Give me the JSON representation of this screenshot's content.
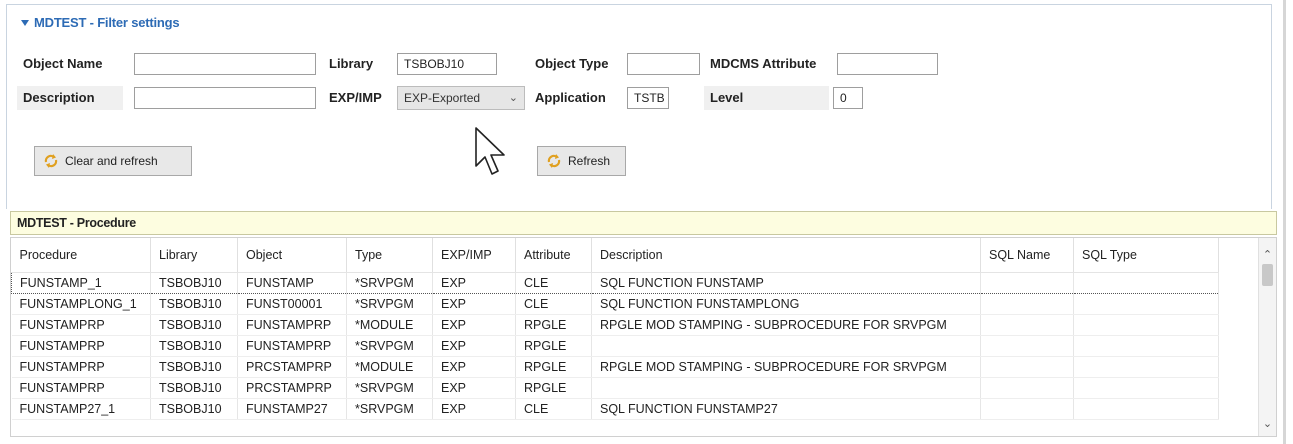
{
  "filter": {
    "title": "MDTEST - Filter settings",
    "labels": {
      "object_name": "Object Name",
      "library": "Library",
      "object_type": "Object Type",
      "mdcms_attribute": "MDCMS Attribute",
      "description": "Description",
      "exp_imp": "EXP/IMP",
      "application": "Application",
      "level": "Level"
    },
    "values": {
      "object_name": "",
      "library": "TSBOBJ10",
      "object_type": "",
      "mdcms_attribute": "",
      "description": "",
      "exp_imp": "EXP-Exported",
      "application": "TSTB",
      "level": "0"
    },
    "buttons": {
      "clear_refresh": "Clear and refresh",
      "refresh": "Refresh"
    }
  },
  "procedure": {
    "title": "MDTEST - Procedure",
    "columns": [
      "Procedure",
      "Library",
      "Object",
      "Type",
      "EXP/IMP",
      "Attribute",
      "Description",
      "SQL Name",
      "SQL Type"
    ],
    "rows": [
      [
        "FUNSTAMP_1",
        "TSBOBJ10",
        "FUNSTAMP",
        "*SRVPGM",
        "EXP",
        "CLE",
        "SQL FUNCTION FUNSTAMP",
        "",
        ""
      ],
      [
        "FUNSTAMPLONG_1",
        "TSBOBJ10",
        "FUNST00001",
        "*SRVPGM",
        "EXP",
        "CLE",
        "SQL FUNCTION FUNSTAMPLONG",
        "",
        ""
      ],
      [
        "FUNSTAMPRP",
        "TSBOBJ10",
        "FUNSTAMPRP",
        "*MODULE",
        "EXP",
        "RPGLE",
        "RPGLE MOD STAMPING - SUBPROCEDURE FOR SRVPGM",
        "",
        ""
      ],
      [
        "FUNSTAMPRP",
        "TSBOBJ10",
        "FUNSTAMPRP",
        "*SRVPGM",
        "EXP",
        "RPGLE",
        "",
        "",
        ""
      ],
      [
        "FUNSTAMPRP",
        "TSBOBJ10",
        "PRCSTAMPRP",
        "*MODULE",
        "EXP",
        "RPGLE",
        "RPGLE MOD STAMPING - SUBPROCEDURE FOR SRVPGM",
        "",
        ""
      ],
      [
        "FUNSTAMPRP",
        "TSBOBJ10",
        "PRCSTAMPRP",
        "*SRVPGM",
        "EXP",
        "RPGLE",
        "",
        "",
        ""
      ],
      [
        "FUNSTAMP27_1",
        "TSBOBJ10",
        "FUNSTAMP27",
        "*SRVPGM",
        "EXP",
        "CLE",
        "SQL FUNCTION FUNSTAMP27",
        "",
        ""
      ]
    ]
  },
  "icons": {
    "collapse": "triangle-down-icon",
    "refresh": "refresh-icon",
    "cursor": "mouse-pointer-icon"
  },
  "colors": {
    "section_title": "#2d6bb5",
    "header_bg": "#fdfde0"
  }
}
